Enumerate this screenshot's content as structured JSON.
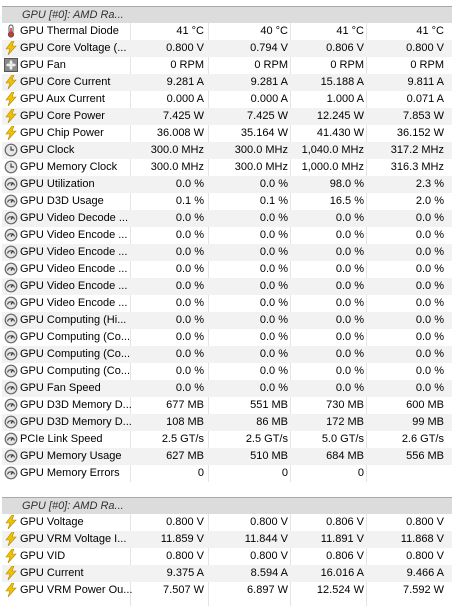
{
  "sections": [
    {
      "title": "GPU [#0]: AMD Ra...",
      "rows": [
        {
          "icon": "thermometer-icon",
          "name": "GPU Thermal Diode",
          "values": [
            "41 °C",
            "40 °C",
            "41 °C",
            "41 °C"
          ]
        },
        {
          "icon": "lightning-icon",
          "name": "GPU Core Voltage (...",
          "values": [
            "0.800 V",
            "0.794 V",
            "0.806 V",
            "0.800 V"
          ]
        },
        {
          "icon": "fan-icon",
          "name": "GPU Fan",
          "values": [
            "0 RPM",
            "0 RPM",
            "0 RPM",
            "0 RPM"
          ]
        },
        {
          "icon": "lightning-icon",
          "name": "GPU Core Current",
          "values": [
            "9.281 A",
            "9.281 A",
            "15.188 A",
            "9.811 A"
          ]
        },
        {
          "icon": "lightning-icon",
          "name": "GPU Aux Current",
          "values": [
            "0.000 A",
            "0.000 A",
            "1.000 A",
            "0.071 A"
          ]
        },
        {
          "icon": "lightning-icon",
          "name": "GPU Core Power",
          "values": [
            "7.425 W",
            "7.425 W",
            "12.245 W",
            "7.853 W"
          ]
        },
        {
          "icon": "lightning-icon",
          "name": "GPU Chip Power",
          "values": [
            "36.008 W",
            "35.164 W",
            "41.430 W",
            "36.152 W"
          ]
        },
        {
          "icon": "clock-icon",
          "name": "GPU Clock",
          "values": [
            "300.0 MHz",
            "300.0 MHz",
            "1,040.0 MHz",
            "317.2 MHz"
          ]
        },
        {
          "icon": "clock-icon",
          "name": "GPU Memory Clock",
          "values": [
            "300.0 MHz",
            "300.0 MHz",
            "1,000.0 MHz",
            "316.3 MHz"
          ]
        },
        {
          "icon": "gauge-icon",
          "name": "GPU Utilization",
          "values": [
            "0.0 %",
            "0.0 %",
            "98.0 %",
            "2.3 %"
          ]
        },
        {
          "icon": "gauge-icon",
          "name": "GPU D3D Usage",
          "values": [
            "0.1 %",
            "0.1 %",
            "16.5 %",
            "2.0 %"
          ]
        },
        {
          "icon": "gauge-icon",
          "name": "GPU Video Decode ...",
          "values": [
            "0.0 %",
            "0.0 %",
            "0.0 %",
            "0.0 %"
          ]
        },
        {
          "icon": "gauge-icon",
          "name": "GPU Video Encode ...",
          "values": [
            "0.0 %",
            "0.0 %",
            "0.0 %",
            "0.0 %"
          ]
        },
        {
          "icon": "gauge-icon",
          "name": "GPU Video Encode ...",
          "values": [
            "0.0 %",
            "0.0 %",
            "0.0 %",
            "0.0 %"
          ]
        },
        {
          "icon": "gauge-icon",
          "name": "GPU Video Encode ...",
          "values": [
            "0.0 %",
            "0.0 %",
            "0.0 %",
            "0.0 %"
          ]
        },
        {
          "icon": "gauge-icon",
          "name": "GPU Video Encode ...",
          "values": [
            "0.0 %",
            "0.0 %",
            "0.0 %",
            "0.0 %"
          ]
        },
        {
          "icon": "gauge-icon",
          "name": "GPU Video Encode ...",
          "values": [
            "0.0 %",
            "0.0 %",
            "0.0 %",
            "0.0 %"
          ]
        },
        {
          "icon": "gauge-icon",
          "name": "GPU Computing (Hi...",
          "values": [
            "0.0 %",
            "0.0 %",
            "0.0 %",
            "0.0 %"
          ]
        },
        {
          "icon": "gauge-icon",
          "name": "GPU Computing (Co...",
          "values": [
            "0.0 %",
            "0.0 %",
            "0.0 %",
            "0.0 %"
          ]
        },
        {
          "icon": "gauge-icon",
          "name": "GPU Computing (Co...",
          "values": [
            "0.0 %",
            "0.0 %",
            "0.0 %",
            "0.0 %"
          ]
        },
        {
          "icon": "gauge-icon",
          "name": "GPU Computing (Co...",
          "values": [
            "0.0 %",
            "0.0 %",
            "0.0 %",
            "0.0 %"
          ]
        },
        {
          "icon": "gauge-icon",
          "name": "GPU Fan Speed",
          "values": [
            "0.0 %",
            "0.0 %",
            "0.0 %",
            "0.0 %"
          ]
        },
        {
          "icon": "gauge-icon",
          "name": "GPU D3D Memory D...",
          "values": [
            "677 MB",
            "551 MB",
            "730 MB",
            "600 MB"
          ]
        },
        {
          "icon": "gauge-icon",
          "name": "GPU D3D Memory D...",
          "values": [
            "108 MB",
            "86 MB",
            "172 MB",
            "99 MB"
          ]
        },
        {
          "icon": "gauge-icon",
          "name": "PCIe Link Speed",
          "values": [
            "2.5 GT/s",
            "2.5 GT/s",
            "5.0 GT/s",
            "2.6 GT/s"
          ]
        },
        {
          "icon": "gauge-icon",
          "name": "GPU Memory Usage",
          "values": [
            "627 MB",
            "510 MB",
            "684 MB",
            "556 MB"
          ]
        },
        {
          "icon": "gauge-icon",
          "name": "GPU Memory Errors",
          "values": [
            "0",
            "0",
            "0",
            ""
          ]
        }
      ]
    },
    {
      "title": "GPU [#0]: AMD Ra...",
      "rows": [
        {
          "icon": "lightning-icon",
          "name": "GPU Voltage",
          "values": [
            "0.800 V",
            "0.800 V",
            "0.806 V",
            "0.800 V"
          ]
        },
        {
          "icon": "lightning-icon",
          "name": "GPU VRM Voltage I...",
          "values": [
            "11.859 V",
            "11.844 V",
            "11.891 V",
            "11.868 V"
          ]
        },
        {
          "icon": "lightning-icon",
          "name": "GPU VID",
          "values": [
            "0.800 V",
            "0.800 V",
            "0.806 V",
            "0.800 V"
          ]
        },
        {
          "icon": "lightning-icon",
          "name": "GPU Current",
          "values": [
            "9.375 A",
            "8.594 A",
            "16.016 A",
            "9.466 A"
          ]
        },
        {
          "icon": "lightning-icon",
          "name": "GPU VRM Power Ou...",
          "values": [
            "7.507 W",
            "6.897 W",
            "12.524 W",
            "7.592 W"
          ]
        }
      ]
    }
  ],
  "colors": {
    "header_bg": "#dcdcdc",
    "alt_row_bg": "#f2f2f2",
    "lightning": "#e8b400",
    "gauge": "#707070"
  }
}
